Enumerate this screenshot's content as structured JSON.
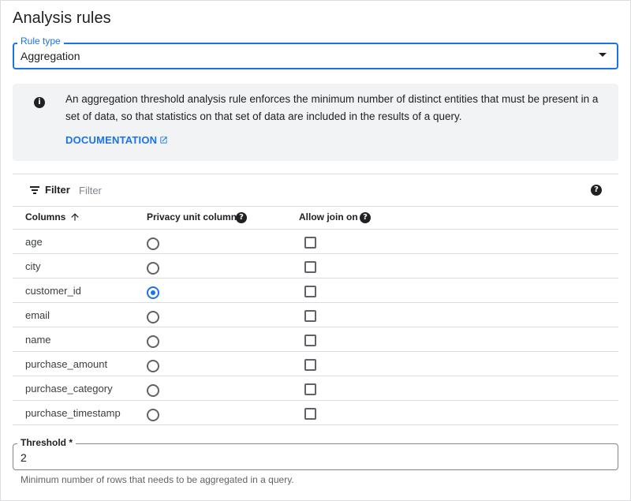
{
  "page": {
    "title": "Analysis rules"
  },
  "rule_type": {
    "label": "Rule type",
    "value": "Aggregation"
  },
  "info": {
    "text": "An aggregation threshold analysis rule enforces the minimum number of distinct entities that must be present in a set of data, so that statistics on that set of data are included in the results of a query.",
    "link_label": "DOCUMENTATION"
  },
  "filter": {
    "label": "Filter",
    "placeholder": "Filter"
  },
  "table": {
    "headers": {
      "columns": "Columns",
      "privacy_unit": "Privacy unit column",
      "allow_join": "Allow join on"
    },
    "rows": [
      {
        "name": "age",
        "privacy_unit": false,
        "allow_join": false
      },
      {
        "name": "city",
        "privacy_unit": false,
        "allow_join": false
      },
      {
        "name": "customer_id",
        "privacy_unit": true,
        "allow_join": false
      },
      {
        "name": "email",
        "privacy_unit": false,
        "allow_join": false
      },
      {
        "name": "name",
        "privacy_unit": false,
        "allow_join": false
      },
      {
        "name": "purchase_amount",
        "privacy_unit": false,
        "allow_join": false
      },
      {
        "name": "purchase_category",
        "privacy_unit": false,
        "allow_join": false
      },
      {
        "name": "purchase_timestamp",
        "privacy_unit": false,
        "allow_join": false
      }
    ]
  },
  "threshold": {
    "label": "Threshold *",
    "value": "2",
    "hint": "Minimum number of rows that needs to be aggregated in a query."
  },
  "icons": {
    "info": "info-icon",
    "external_link": "open-in-new-icon",
    "filter": "filter-icon",
    "help": "help-icon",
    "sort": "arrow-upward-icon",
    "dropdown": "arrow-drop-down-icon"
  },
  "colors": {
    "accent": "#1a73e8",
    "info_bg": "#f1f3f4",
    "border": "#dadce0",
    "text": "#202124"
  }
}
